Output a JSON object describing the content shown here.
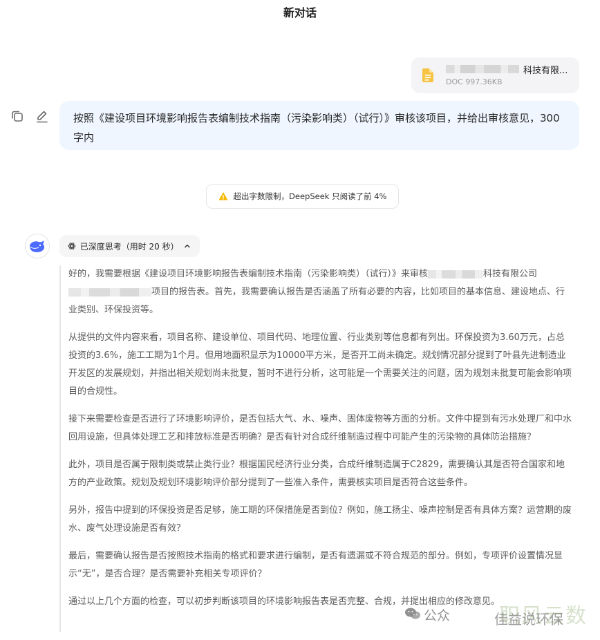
{
  "header": {
    "title": "新对话"
  },
  "file": {
    "name_visible": "科技有限...",
    "meta": "DOC 997.36KB",
    "icon": "doc-file-icon",
    "icon_color": "#f6c343"
  },
  "user_message": {
    "text": "按照《建设项目环境影响报告表编制技术指南（污染影响类）（试行）》审核该项目，并给出审核意见，300字内",
    "actions": [
      "copy-icon",
      "edit-icon"
    ]
  },
  "warning": {
    "icon": "warning-icon",
    "text": "超出字数限制，DeepSeek 只阅读了前 4%"
  },
  "assistant": {
    "avatar": "deepseek-whale-icon",
    "thinking_label": "已深度思考（用时 20 秒）",
    "paragraphs": {
      "p1a": "好的，我需要根据《建设项目环境影响报告表编制技术指南（污染影响类）（试行）》来审核",
      "p1b": "科技有限公司",
      "p1c": "项目的报告表。首先，我需要确认报告是否涵盖了所有必要的内容，比如项目的基本信息、建设地点、行业类别、环保投资等。",
      "p2": "从提供的文件内容来看，项目名称、建设单位、项目代码、地理位置、行业类别等信息都有列出。环保投资为3.60万元，占总投资的3.6%，施工工期为1个月。但用地面积显示为10000平方米，是否开工尚未确定。规划情况部分提到了叶县先进制造业开发区的发展规划，并指出相关规划尚未批复，暂时不进行分析，这可能是一个需要关注的问题，因为规划未批复可能会影响项目的合规性。",
      "p3": "接下来需要检查是否进行了环境影响评价，是否包括大气、水、噪声、固体废物等方面的分析。文件中提到有污水处理厂和中水回用设施，但具体处理工艺和排放标准是否明确？是否有针对合成纤维制造过程中可能产生的污染物的具体防治措施？",
      "p4": "此外，项目是否属于限制类或禁止类行业？根据国民经济行业分类，合成纤维制造属于C2829，需要确认其是否符合国家和地方的产业政策。规划及规划环境影响评价部分提到了一些准入条件，需要核实项目是否符合这些条件。",
      "p5": "另外，报告中提到的环保投资是否足够，施工期的环保措施是否到位？例如，施工扬尘、噪声控制是否有具体方案？运营期的废水、废气处理设施是否有效？",
      "p6": "最后，需要确认报告是否按照技术指南的格式和要求进行编制，是否有遗漏或不符合规范的部分。例如，专项评价设置情况显示“无”，是否合理？是否需要补充相关专项评价？",
      "p7": "通过以上几个方面的检查，可以初步判断该项目的环境影响报告表是否完整、合规，并提出相应的修改意见。"
    }
  },
  "watermark": {
    "text_left": "公众",
    "text_faint": "职风云数",
    "text_right": "佳益说环保"
  },
  "colors": {
    "user_bubble_bg": "#eff6ff",
    "thinking_text": "#5a5a5a",
    "warning_icon": "#f5b700",
    "avatar_blue": "#4d6bfe"
  }
}
